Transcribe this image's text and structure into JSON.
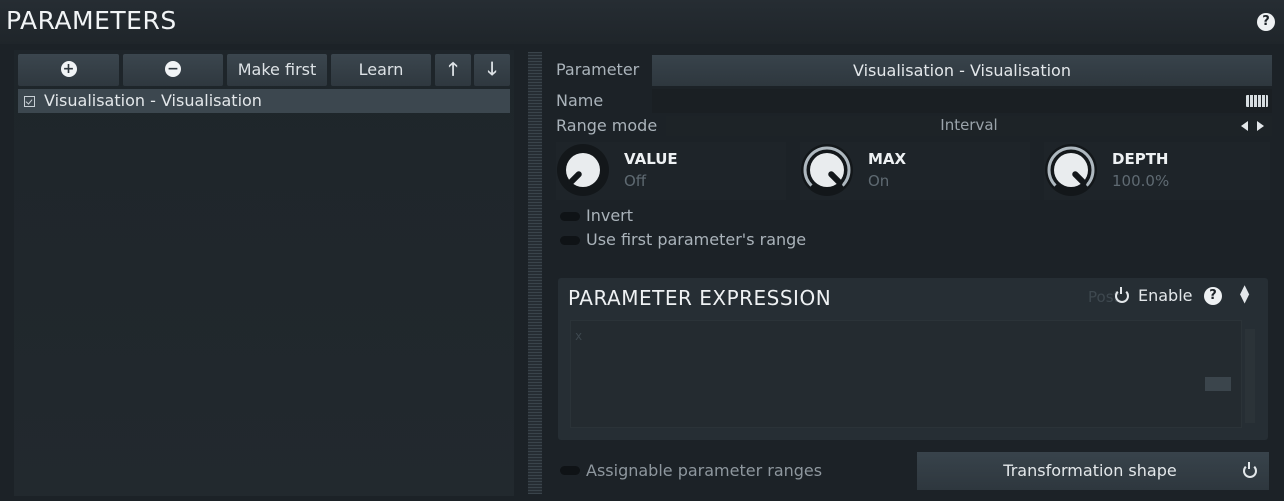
{
  "header": {
    "title": "PARAMETERS",
    "help_glyph": "?"
  },
  "toolbar": {
    "add_glyph": "+",
    "remove_glyph": "−",
    "make_first_label": "Make first",
    "learn_label": "Learn",
    "up_glyph": "🡑",
    "down_glyph": "🡓"
  },
  "list": {
    "items": [
      {
        "label": "Visualisation - Visualisation",
        "checked": true
      }
    ]
  },
  "details": {
    "parameter_label": "Parameter",
    "parameter_value": "Visualisation - Visualisation",
    "name_label": "Name",
    "range_mode_label": "Range mode",
    "range_mode_value": "Interval"
  },
  "knobs": [
    {
      "title": "VALUE",
      "value": "Off",
      "level": 0.0
    },
    {
      "title": "MAX",
      "value": "On",
      "level": 1.0
    },
    {
      "title": "DEPTH",
      "value": "100.0%",
      "level": 1.0
    }
  ],
  "toggles": {
    "invert": "Invert",
    "first_range": "Use first parameter's range"
  },
  "expression": {
    "title": "PARAMETER EXPRESSION",
    "post": "Post",
    "enable": "Enable",
    "help_glyph": "?",
    "editor_text": "x"
  },
  "bottom": {
    "assignable": "Assignable parameter ranges",
    "transformation": "Transformation shape"
  },
  "colors": {
    "accent": "#aeb8bf",
    "background": "#1c2227",
    "button": "#343e45"
  }
}
